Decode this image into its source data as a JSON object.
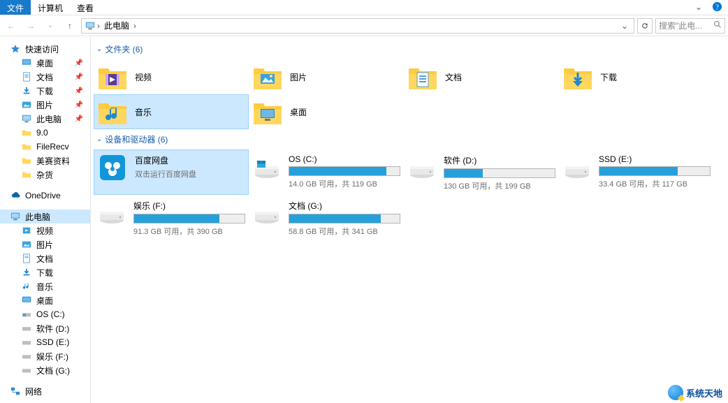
{
  "menu": {
    "file": "文件",
    "computer": "计算机",
    "view": "查看"
  },
  "nav": {
    "location": "此电脑",
    "search_placeholder": "搜索\"此电...",
    "monitor_name": "monitor-icon"
  },
  "sidebar": {
    "quick": "快速访问",
    "pinned": [
      {
        "label": "桌面",
        "icon": "desktop"
      },
      {
        "label": "文档",
        "icon": "doc"
      },
      {
        "label": "下载",
        "icon": "download"
      },
      {
        "label": "图片",
        "icon": "picture"
      },
      {
        "label": "此电脑",
        "icon": "pc"
      }
    ],
    "folders": [
      {
        "label": "9.0"
      },
      {
        "label": "FileRecv"
      },
      {
        "label": "美赛资料"
      },
      {
        "label": "杂货"
      }
    ],
    "onedrive": "OneDrive",
    "thispc": "此电脑",
    "pc_children": [
      {
        "label": "视频",
        "icon": "video"
      },
      {
        "label": "图片",
        "icon": "picture"
      },
      {
        "label": "文档",
        "icon": "doc"
      },
      {
        "label": "下载",
        "icon": "download"
      },
      {
        "label": "音乐",
        "icon": "music"
      },
      {
        "label": "桌面",
        "icon": "desktop"
      },
      {
        "label": "OS (C:)",
        "icon": "drive-win"
      },
      {
        "label": "软件 (D:)",
        "icon": "drive"
      },
      {
        "label": "SSD (E:)",
        "icon": "drive"
      },
      {
        "label": "娱乐 (F:)",
        "icon": "drive"
      },
      {
        "label": "文档 (G:)",
        "icon": "drive"
      }
    ],
    "network": "网络"
  },
  "groups": {
    "folders_title": "文件夹 (6)",
    "drives_title": "设备和驱动器 (6)"
  },
  "folders_grid": [
    {
      "label": "视频",
      "icon": "video",
      "selected": false
    },
    {
      "label": "图片",
      "icon": "picture",
      "selected": false
    },
    {
      "label": "文档",
      "icon": "doc",
      "selected": false
    },
    {
      "label": "下载",
      "icon": "download",
      "selected": false
    },
    {
      "label": "音乐",
      "icon": "music",
      "selected": true
    },
    {
      "label": "桌面",
      "icon": "desktop",
      "selected": false
    }
  ],
  "drives": [
    {
      "name": "百度网盘",
      "sub": "双击运行百度网盘",
      "icon": "baidu",
      "fill_pct": 0,
      "stat": "",
      "selected": true
    },
    {
      "name": "OS (C:)",
      "icon": "drive-win",
      "fill_pct": 88,
      "stat": "14.0 GB 可用，共 119 GB"
    },
    {
      "name": "软件 (D:)",
      "icon": "drive",
      "fill_pct": 35,
      "stat": "130 GB 可用，共 199 GB"
    },
    {
      "name": "SSD (E:)",
      "icon": "drive",
      "fill_pct": 71,
      "stat": "33.4 GB 可用，共 117 GB"
    },
    {
      "name": "娱乐 (F:)",
      "icon": "drive",
      "fill_pct": 77,
      "stat": "91.3 GB 可用，共 390 GB"
    },
    {
      "name": "文档 (G:)",
      "icon": "drive",
      "fill_pct": 83,
      "stat": "58.8 GB 可用，共 341 GB"
    }
  ],
  "watermark": "系统天地"
}
